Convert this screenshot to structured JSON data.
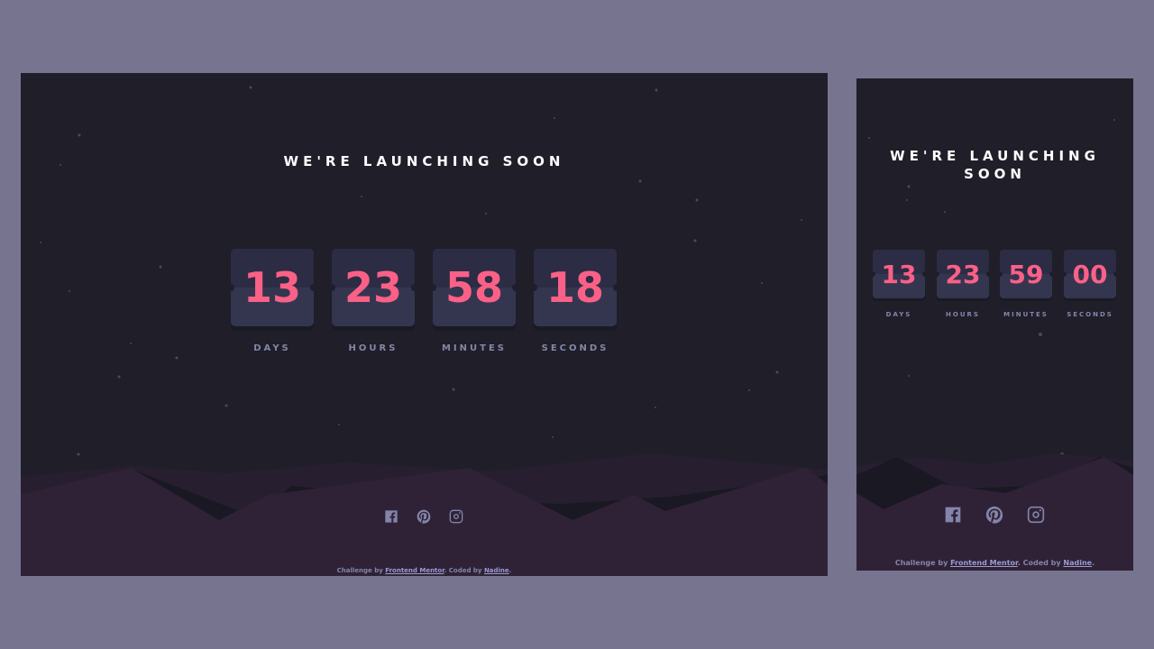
{
  "title": "WE'RE LAUNCHING SOON",
  "desktop": {
    "countdown": [
      {
        "value": "13",
        "label": "DAYS"
      },
      {
        "value": "23",
        "label": "HOURS"
      },
      {
        "value": "58",
        "label": "MINUTES"
      },
      {
        "value": "18",
        "label": "SECONDS"
      }
    ]
  },
  "mobile": {
    "countdown": [
      {
        "value": "13",
        "label": "DAYS"
      },
      {
        "value": "23",
        "label": "HOURS"
      },
      {
        "value": "59",
        "label": "MINUTES"
      },
      {
        "value": "00",
        "label": "SECONDS"
      }
    ]
  },
  "socials": [
    {
      "icon": "facebook-icon"
    },
    {
      "icon": "pinterest-icon"
    },
    {
      "icon": "instagram-icon"
    }
  ],
  "attribution": {
    "prefix": "Challenge by ",
    "challenge_link": "Frontend Mentor",
    "middle": ". Coded by ",
    "author_link": "Nadine",
    "suffix": "."
  },
  "colors": {
    "page_background": "#77748f",
    "frame_background": "#1f1e29",
    "digit": "#fb6087",
    "card": "#343650",
    "label": "#8486a9",
    "hills_front": "#2f2237",
    "hills_back": "#271f30"
  }
}
